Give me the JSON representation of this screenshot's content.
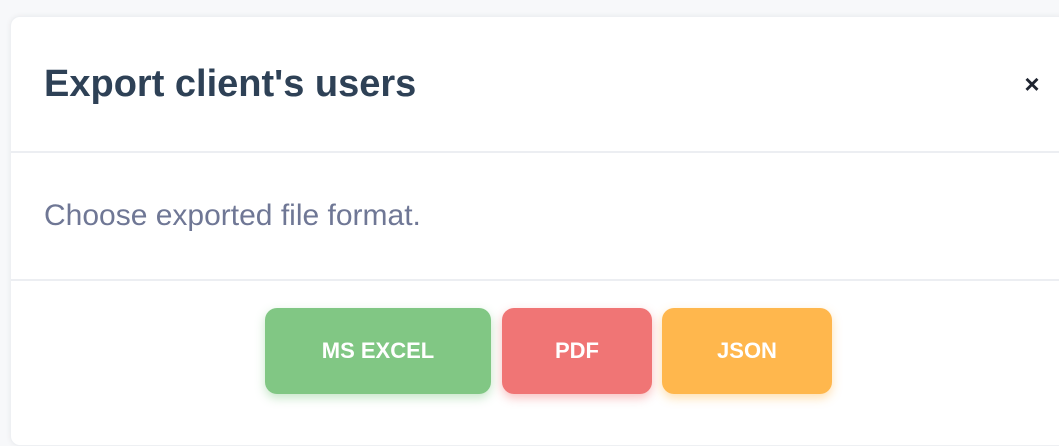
{
  "modal": {
    "title": "Export client's users",
    "close_label": "×",
    "body_text": "Choose exported file format."
  },
  "buttons": [
    {
      "label": "MS EXCEL",
      "color": "#81c784"
    },
    {
      "label": "PDF",
      "color": "#f07575"
    },
    {
      "label": "JSON",
      "color": "#ffb74d"
    }
  ],
  "colors": {
    "title": "#2e4156",
    "body_text": "#6f7795",
    "background": "#ffffff"
  }
}
